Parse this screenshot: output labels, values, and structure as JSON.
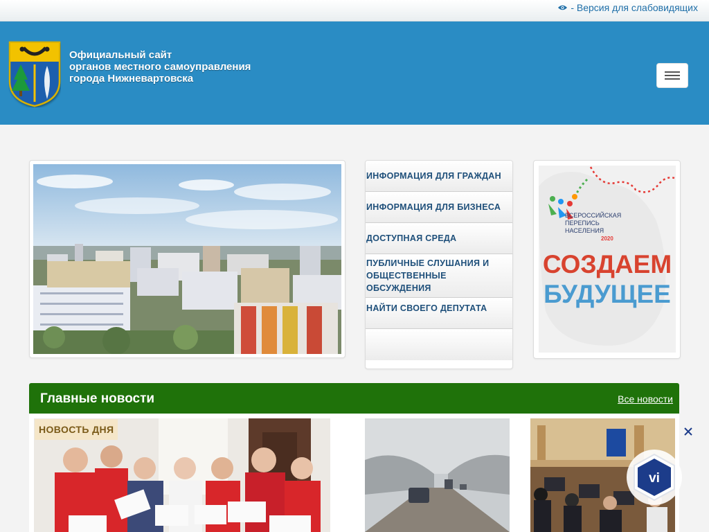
{
  "topbar": {
    "accessibility_link": "- Версия для слабовидящих",
    "icon": "eye-icon"
  },
  "header": {
    "site_title": "Официальный сайт\nорганов местного самоуправления\nгорода Нижневартовска",
    "background": "#2a8cc4",
    "menu_icon": "hamburger-icon"
  },
  "hero": {
    "image": "city-panorama-photo"
  },
  "links_menu": {
    "items": [
      {
        "label": "ИНФОРМАЦИЯ ДЛЯ ГРАЖДАН"
      },
      {
        "label": "ИНФОРМАЦИЯ ДЛЯ БИЗНЕСА"
      },
      {
        "label": "ДОСТУПНАЯ СРЕДА"
      },
      {
        "label": "ПУБЛИЧНЫЕ СЛУШАНИЯ И ОБЩЕСТВЕННЫЕ ОБСУЖДЕНИЯ"
      },
      {
        "label": "НАЙТИ СВОЕГО ДЕПУТАТА"
      },
      {
        "label": ""
      }
    ],
    "text_color": "#1e4f7a"
  },
  "census_banner": {
    "line1": "ВСЕРОССИЙСКАЯ",
    "line2": "ПЕРЕПИСЬ",
    "line3": "НАСЕЛЕНИЯ",
    "year": "2020",
    "slogan1": "СОЗДАЕМ",
    "slogan2": "БУДУЩЕЕ"
  },
  "news": {
    "title": "Главные новости",
    "all_news_label": "Все новости",
    "bar_color": "#1f720a",
    "badge": "НОВОСТЬ ДНЯ",
    "items": [
      {
        "image": "volunteers-photo"
      },
      {
        "image": "snowy-road-photo"
      },
      {
        "image": "council-meeting-photo"
      }
    ]
  },
  "widget": {
    "label": "vi",
    "close_icon": "close-icon"
  }
}
